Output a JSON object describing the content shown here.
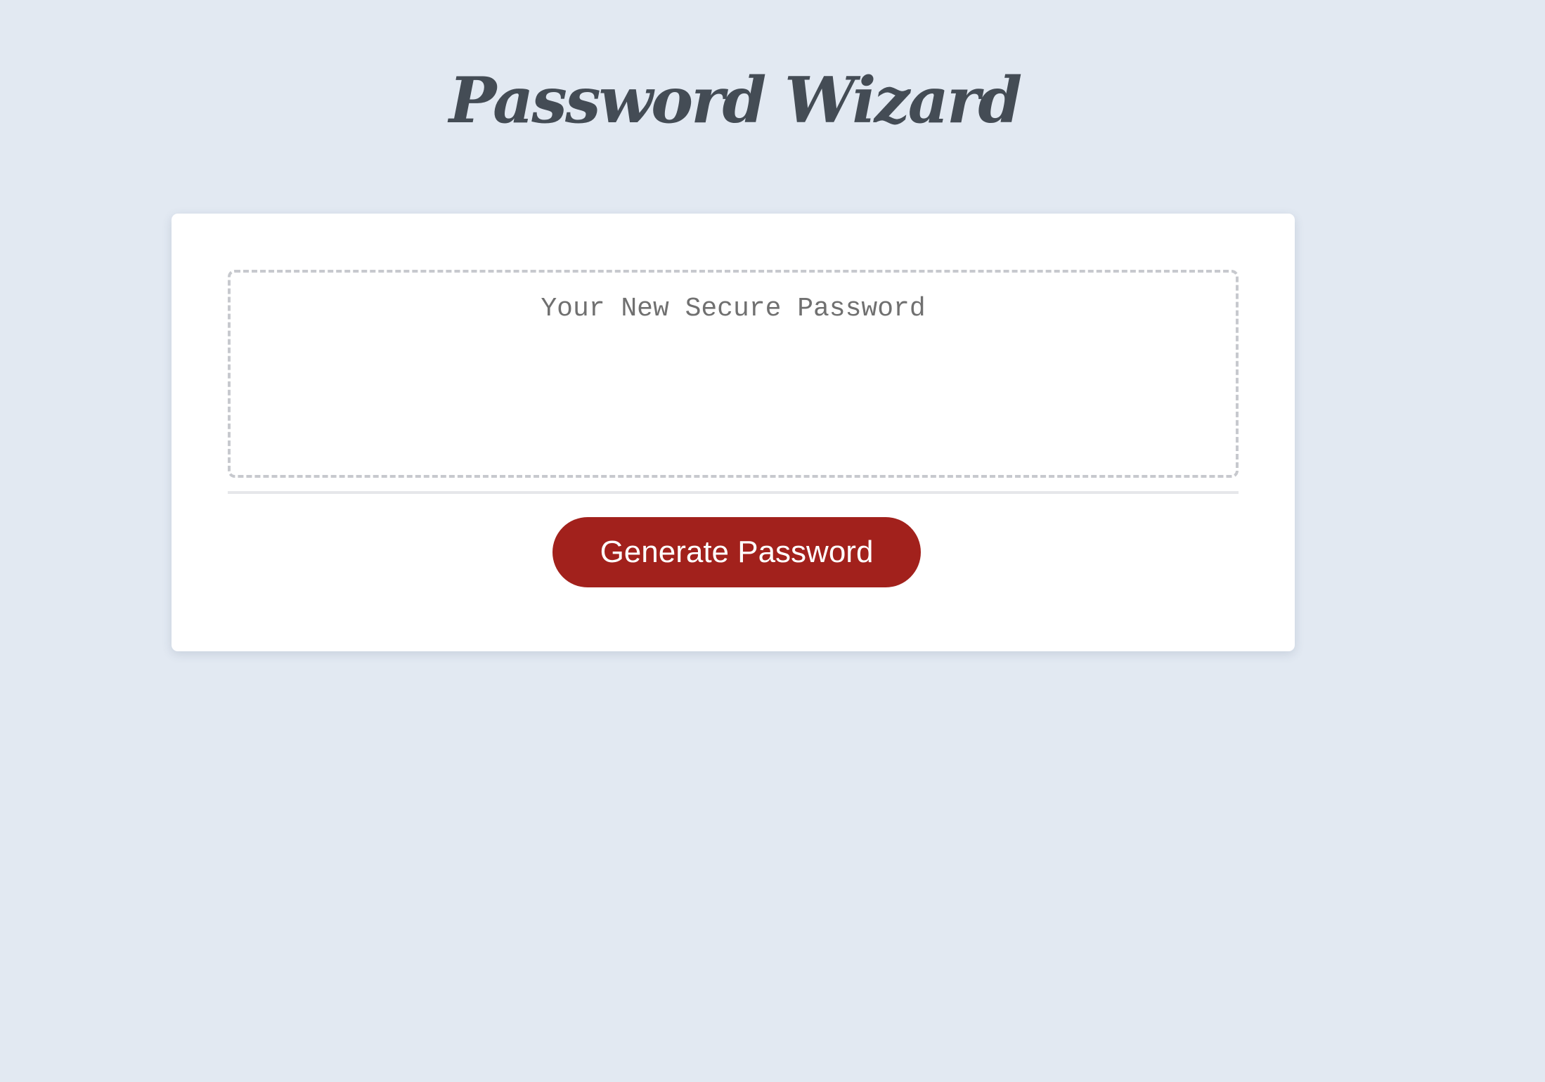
{
  "header": {
    "title": "Password Wizard"
  },
  "card": {
    "password_field": {
      "value": "",
      "placeholder": "Your New Secure Password"
    },
    "generate_button": {
      "label": "Generate Password"
    }
  },
  "colors": {
    "background": "#e2e9f2",
    "card": "#ffffff",
    "title": "#444c55",
    "button": "#a2211c",
    "button_text": "#ffffff",
    "dashed_border": "#c7c9ce"
  }
}
